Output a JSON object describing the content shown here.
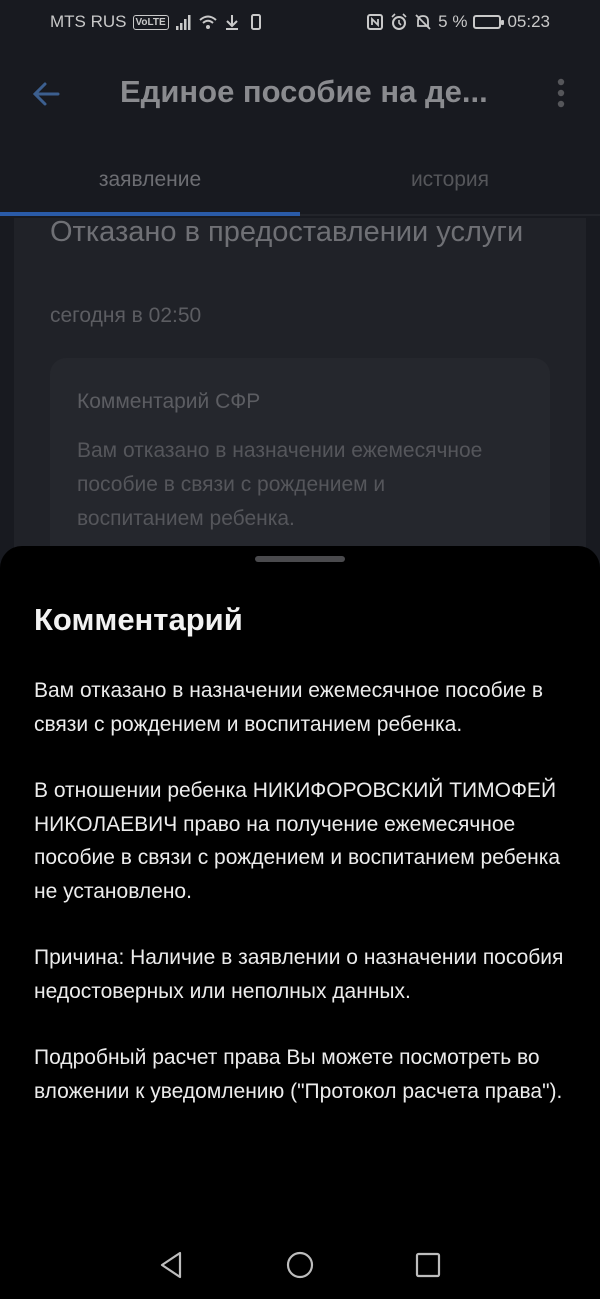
{
  "status_bar": {
    "carrier": "MTS RUS",
    "volte": "VoLTE",
    "battery": "5 %",
    "time": "05:23"
  },
  "app_bar": {
    "title": "Единое пособие на де..."
  },
  "tabs": [
    {
      "label": "заявление",
      "active": true
    },
    {
      "label": "история",
      "active": false
    }
  ],
  "status_card": {
    "title": "Отказано в предоставлении услуги",
    "time": "сегодня в 02:50",
    "comment_label": "Комментарий СФР",
    "comment_preview": "Вам отказано в назначении ежемесячное пособие в связи с рождением и воспитанием ребенка."
  },
  "sheet": {
    "title": "Комментарий",
    "paragraphs": [
      "Вам отказано в назначении ежемесячное пособие в связи с рождением и воспитанием ребенка.",
      "В отношении ребенка НИКИФОРОВСКИЙ ТИМОФЕЙ НИКОЛАЕВИЧ право на получение ежемесячное пособие в связи с рождением и воспитанием ребенка не установлено.",
      "Причина: Наличие в заявлении о назначении пособия недостоверных или неполных данных.",
      "Подробный расчет права Вы можете посмотреть во вложении к уведомлению (\"Протокол расчета права\")."
    ]
  },
  "colors": {
    "accent": "#2a5ba8",
    "background": "#181a20",
    "sheet_background": "#000000"
  }
}
